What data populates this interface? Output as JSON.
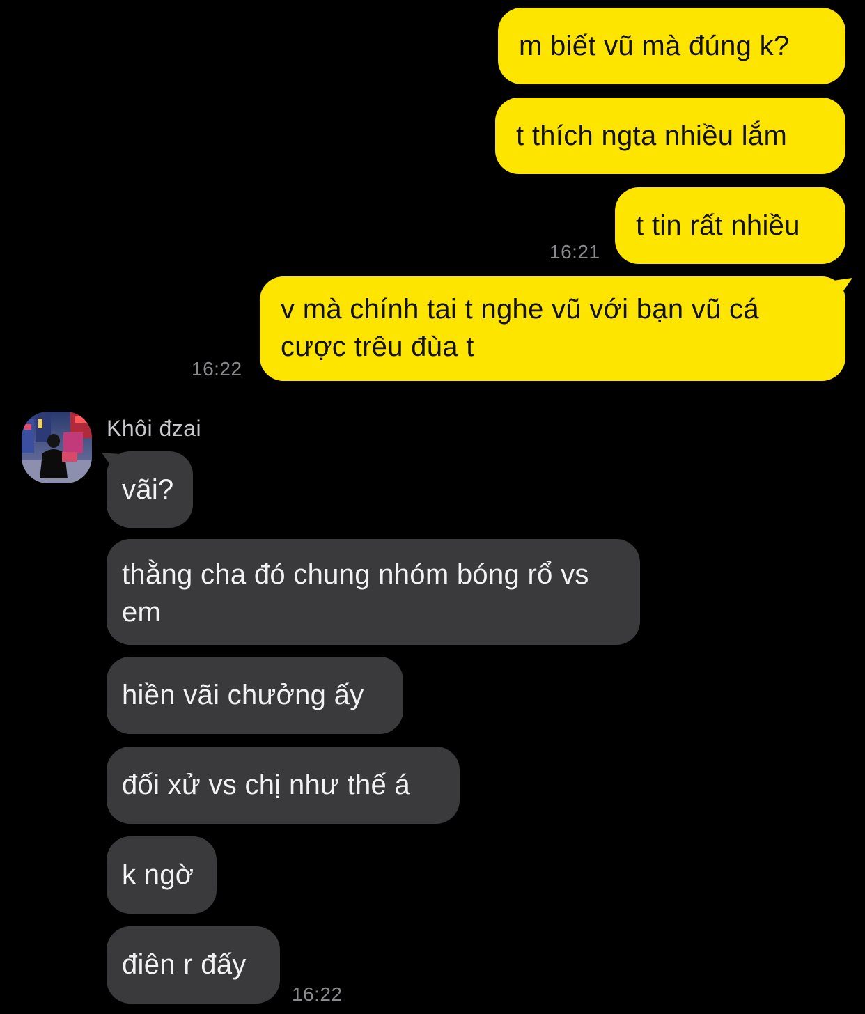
{
  "sent_messages": [
    {
      "text": "m biết vũ mà đúng k?"
    },
    {
      "text": "t thích ngta nhiều lắm"
    },
    {
      "text": "t tin rất nhiều",
      "time": "16:21"
    },
    {
      "text": "v mà chính tai t nghe vũ với bạn vũ cá cược trêu đùa t",
      "time": "16:22"
    }
  ],
  "sender": {
    "name": "Khôi đzai",
    "avatar_icon": "profile-photo-icon"
  },
  "received_messages": [
    {
      "text": "vãi?"
    },
    {
      "text": "thằng cha đó chung nhóm bóng rổ vs em"
    },
    {
      "text": "hiền vãi chưởng ấy"
    },
    {
      "text": "đối xử vs chị như thế á"
    },
    {
      "text": "k ngờ"
    },
    {
      "text": "điên r đấy",
      "time": "16:22"
    }
  ],
  "colors": {
    "background": "#000000",
    "sent_bubble": "#FEE500",
    "received_bubble": "#3a3a3c",
    "timestamp": "#8a8a8e"
  }
}
